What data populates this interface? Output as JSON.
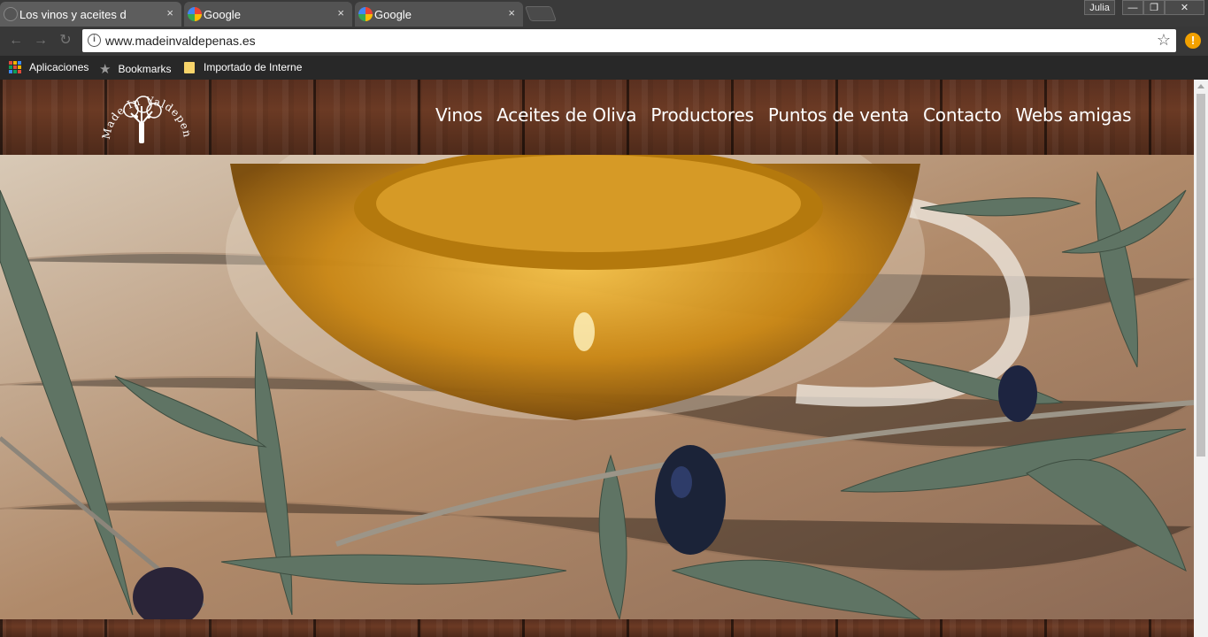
{
  "browser": {
    "tabs": [
      {
        "title": "Los vinos y aceites de Va",
        "close": "×",
        "active": true
      },
      {
        "title": "Google",
        "close": "×",
        "active": false
      },
      {
        "title": "Google",
        "close": "×",
        "active": false
      }
    ],
    "user": "Julia",
    "window_buttons": {
      "minimize": "—",
      "maximize": "❐",
      "close": "✕"
    },
    "url": "www.madeinvaldepenas.es",
    "nav": {
      "back": "←",
      "forward": "→",
      "reload": "↻"
    },
    "bookmarks": [
      {
        "label": "Aplicaciones",
        "icon": "apps-grid-icon"
      },
      {
        "label": "Bookmarks",
        "icon": "star-icon"
      },
      {
        "label": "Importado de Interne",
        "icon": "folder-icon"
      }
    ]
  },
  "site": {
    "logo_text": "Made In Valdepeñas",
    "nav": [
      "Vinos",
      "Aceites de Oliva",
      "Productores",
      "Puntos de venta",
      "Contacto",
      "Webs amigas"
    ]
  },
  "colors": {
    "wood": "#5a3020",
    "oil": "#d99a1a",
    "leaf": "#556b5a"
  }
}
